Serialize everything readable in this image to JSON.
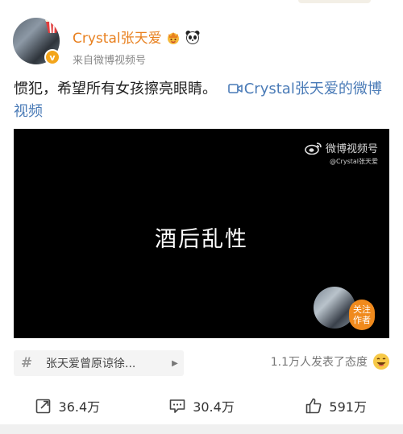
{
  "post": {
    "author": {
      "name": "Crystal张天爱",
      "verified_mark": "v",
      "badges": [
        "crown-icon",
        "panda-icon"
      ],
      "source": "来自微博视频号"
    },
    "text": "惯犯，希望所有女孩擦亮眼睛。",
    "video_link_text": "Crystal张天爱的微博视频",
    "video": {
      "watermark_brand": "微博视频号",
      "watermark_handle": "@Crystal张天爱",
      "caption": "酒后乱性",
      "follow_label": "关注作者"
    },
    "topic": {
      "hash": "#",
      "label": "张天爱曾原谅徐...",
      "arrow": "▶"
    },
    "reactions": {
      "text": "1.1万人发表了态度"
    },
    "actions": {
      "repost": "36.4万",
      "comment": "30.4万",
      "like": "591万"
    }
  },
  "colors": {
    "username": "#e8801f",
    "link": "#4a7bb7",
    "follow_badge": "#f08a1d"
  }
}
